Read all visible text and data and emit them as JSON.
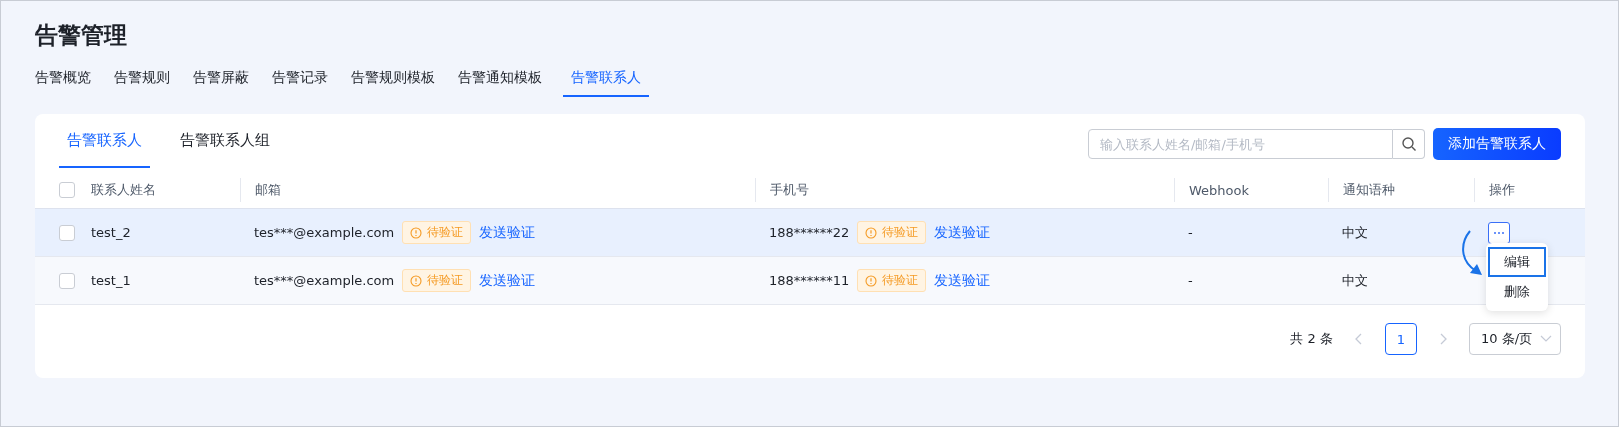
{
  "page_title": "告警管理",
  "tabs": [
    {
      "label": "告警概览",
      "selected": false
    },
    {
      "label": "告警规则",
      "selected": false
    },
    {
      "label": "告警屏蔽",
      "selected": false
    },
    {
      "label": "告警记录",
      "selected": false
    },
    {
      "label": "告警规则模板",
      "selected": false
    },
    {
      "label": "告警通知模板",
      "selected": false
    },
    {
      "label": "告警联系人",
      "selected": true
    }
  ],
  "sub_tabs": [
    {
      "label": "告警联系人",
      "selected": true
    },
    {
      "label": "告警联系人组",
      "selected": false
    }
  ],
  "search": {
    "placeholder": "输入联系人姓名/邮箱/手机号"
  },
  "add_button": "添加告警联系人",
  "table": {
    "columns": [
      "联系人姓名",
      "邮箱",
      "手机号",
      "Webhook",
      "通知语种",
      "操作"
    ],
    "select_all_checked": false,
    "rows": [
      {
        "checked": false,
        "highlighted": true,
        "name": "test_2",
        "email": "tes***@example.com",
        "email_status": "待验证",
        "email_action": "发送验证",
        "phone": "188******22",
        "phone_status": "待验证",
        "phone_action": "发送验证",
        "webhook": "-",
        "language": "中文",
        "menu_open": true
      },
      {
        "checked": false,
        "highlighted": false,
        "name": "test_1",
        "email": "tes***@example.com",
        "email_status": "待验证",
        "email_action": "发送验证",
        "phone": "188******11",
        "phone_status": "待验证",
        "phone_action": "发送验证",
        "webhook": "-",
        "language": "中文",
        "menu_open": false
      }
    ]
  },
  "row_menu": [
    {
      "label": "编辑",
      "selected": true
    },
    {
      "label": "删除",
      "selected": false
    }
  ],
  "pagination": {
    "total": "共 2 条",
    "pages": [
      {
        "label": "1",
        "selected": true
      }
    ],
    "page_size": "10 条/页"
  }
}
